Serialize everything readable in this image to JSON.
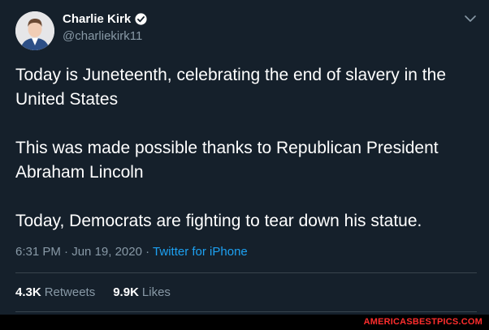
{
  "tweet": {
    "author": {
      "name": "Charlie Kirk",
      "handle": "@charliekirk11",
      "verified": true
    },
    "paragraphs": [
      "Today is Juneteenth, celebrating the end of slavery in the United States",
      "This was made possible thanks to Republican President Abraham Lincoln",
      "Today, Democrats are fighting to tear down his statue."
    ],
    "time": "6:31 PM",
    "date": "Jun 19, 2020",
    "source": "Twitter for iPhone",
    "stats": {
      "retweets_count": "4.3K",
      "retweets_label": "Retweets",
      "likes_count": "9.9K",
      "likes_label": "Likes"
    }
  },
  "icons": {
    "verified": "verified-badge-icon",
    "menu": "chevron-down-icon"
  },
  "colors": {
    "background": "#15202b",
    "primary_text": "#ffffff",
    "secondary_text": "#8899a6",
    "link": "#1da1f2",
    "divider": "#38444d",
    "watermark": "#ff2d2d"
  },
  "watermark": "AMERICASBESTPICS.COM"
}
